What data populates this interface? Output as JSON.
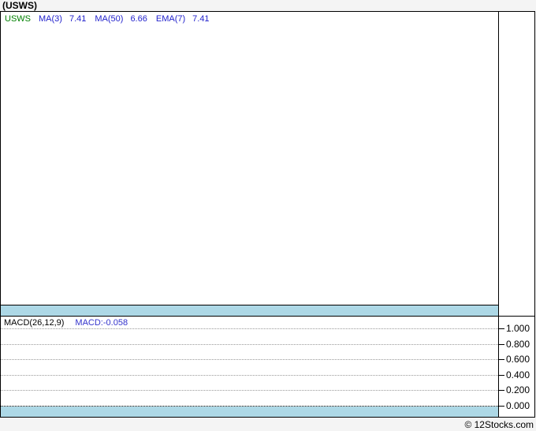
{
  "title": "(USWS)",
  "price_panel": {
    "legend": {
      "symbol": "USWS",
      "items": [
        {
          "label": "MA(3)",
          "value": "7.41"
        },
        {
          "label": "MA(50)",
          "value": "6.66"
        },
        {
          "label": "EMA(7)",
          "value": "7.41"
        }
      ]
    }
  },
  "macd_panel": {
    "label": "MACD(26,12,9)",
    "value_label": "MACD:-0.058",
    "axis_ticks": [
      "1.000",
      "0.800",
      "0.600",
      "0.400",
      "0.200",
      "0.000"
    ]
  },
  "footer": {
    "copyright": "© 12Stocks.com"
  },
  "colors": {
    "band-blue": "#add8e6",
    "symbol-green": "#008000",
    "indicator-blue": "#2222cc",
    "macd-value-blue": "#3333cc",
    "page-bg": "#f4f4f4",
    "border-black": "#000000"
  },
  "chart_data": {
    "type": "line",
    "title": "(USWS)",
    "panels": [
      {
        "name": "price",
        "symbol": "USWS",
        "indicators": [
          {
            "name": "MA(3)",
            "value": 7.41
          },
          {
            "name": "MA(50)",
            "value": 6.66
          },
          {
            "name": "EMA(7)",
            "value": 7.41
          }
        ],
        "series": [],
        "note": "price plot area is empty in the screenshot"
      },
      {
        "name": "macd",
        "label": "MACD(26,12,9)",
        "macd_value": -0.058,
        "ylim": [
          0.0,
          1.0
        ],
        "yticks": [
          1.0,
          0.8,
          0.6,
          0.4,
          0.2,
          0.0
        ],
        "grid": "dotted-horizontal",
        "legend_position": "top-left",
        "series": []
      }
    ],
    "source_watermark": "© 12Stocks.com"
  }
}
